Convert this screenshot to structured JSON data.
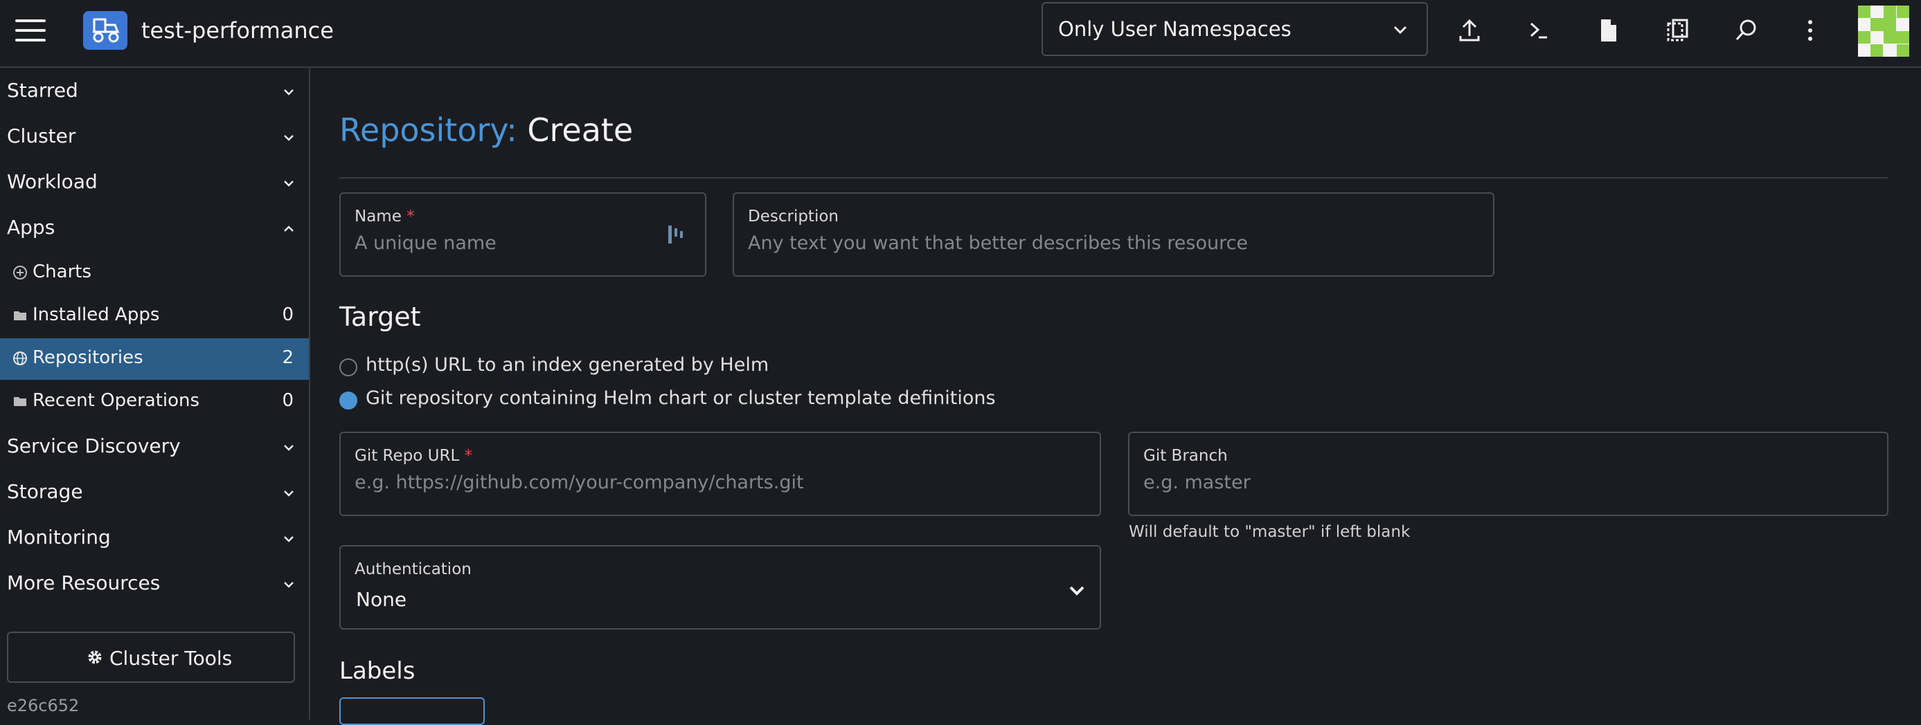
{
  "header": {
    "cluster_name": "test-performance",
    "namespace_filter": "Only User Namespaces",
    "icons": [
      "import-yaml-icon",
      "kubectl-shell-icon",
      "kubeconfig-file-icon",
      "copy-kubeconfig-icon",
      "resource-search-icon",
      "more-actions-icon"
    ]
  },
  "sidebar": {
    "groups": [
      {
        "label": "Starred"
      },
      {
        "label": "Cluster"
      },
      {
        "label": "Workload"
      },
      {
        "label": "Apps"
      },
      {
        "label": "Service Discovery"
      },
      {
        "label": "Storage"
      },
      {
        "label": "Monitoring"
      },
      {
        "label": "More Resources"
      }
    ],
    "apps_items": [
      {
        "label": "Charts",
        "count": ""
      },
      {
        "label": "Installed Apps",
        "count": "0"
      },
      {
        "label": "Repositories",
        "count": "2"
      },
      {
        "label": "Recent Operations",
        "count": "0"
      }
    ],
    "cluster_tools": "Cluster Tools",
    "version": "e26c652"
  },
  "main": {
    "title_resource": "Repository:",
    "title_action": "Create",
    "name": {
      "label": "Name",
      "required_mark": "*",
      "placeholder": "A unique name"
    },
    "description": {
      "label": "Description",
      "placeholder": "Any text you want that better describes this resource"
    },
    "target": {
      "heading": "Target",
      "options": [
        {
          "label": "http(s) URL to an index generated by Helm",
          "selected": false
        },
        {
          "label": "Git repository containing Helm chart or cluster template definitions",
          "selected": true
        }
      ]
    },
    "git_repo_url": {
      "label": "Git Repo URL",
      "required_mark": "*",
      "placeholder": "e.g. https://github.com/your-company/charts.git"
    },
    "git_branch": {
      "label": "Git Branch",
      "placeholder": "e.g. master",
      "hint": "Will default to \"master\" if left blank"
    },
    "authentication": {
      "label": "Authentication",
      "value": "None"
    },
    "labels_heading": "Labels"
  },
  "colors": {
    "accent": "#4a95d6",
    "active_nav": "#2b5d88",
    "required": "#e5484d",
    "background": "#1b1c21"
  }
}
